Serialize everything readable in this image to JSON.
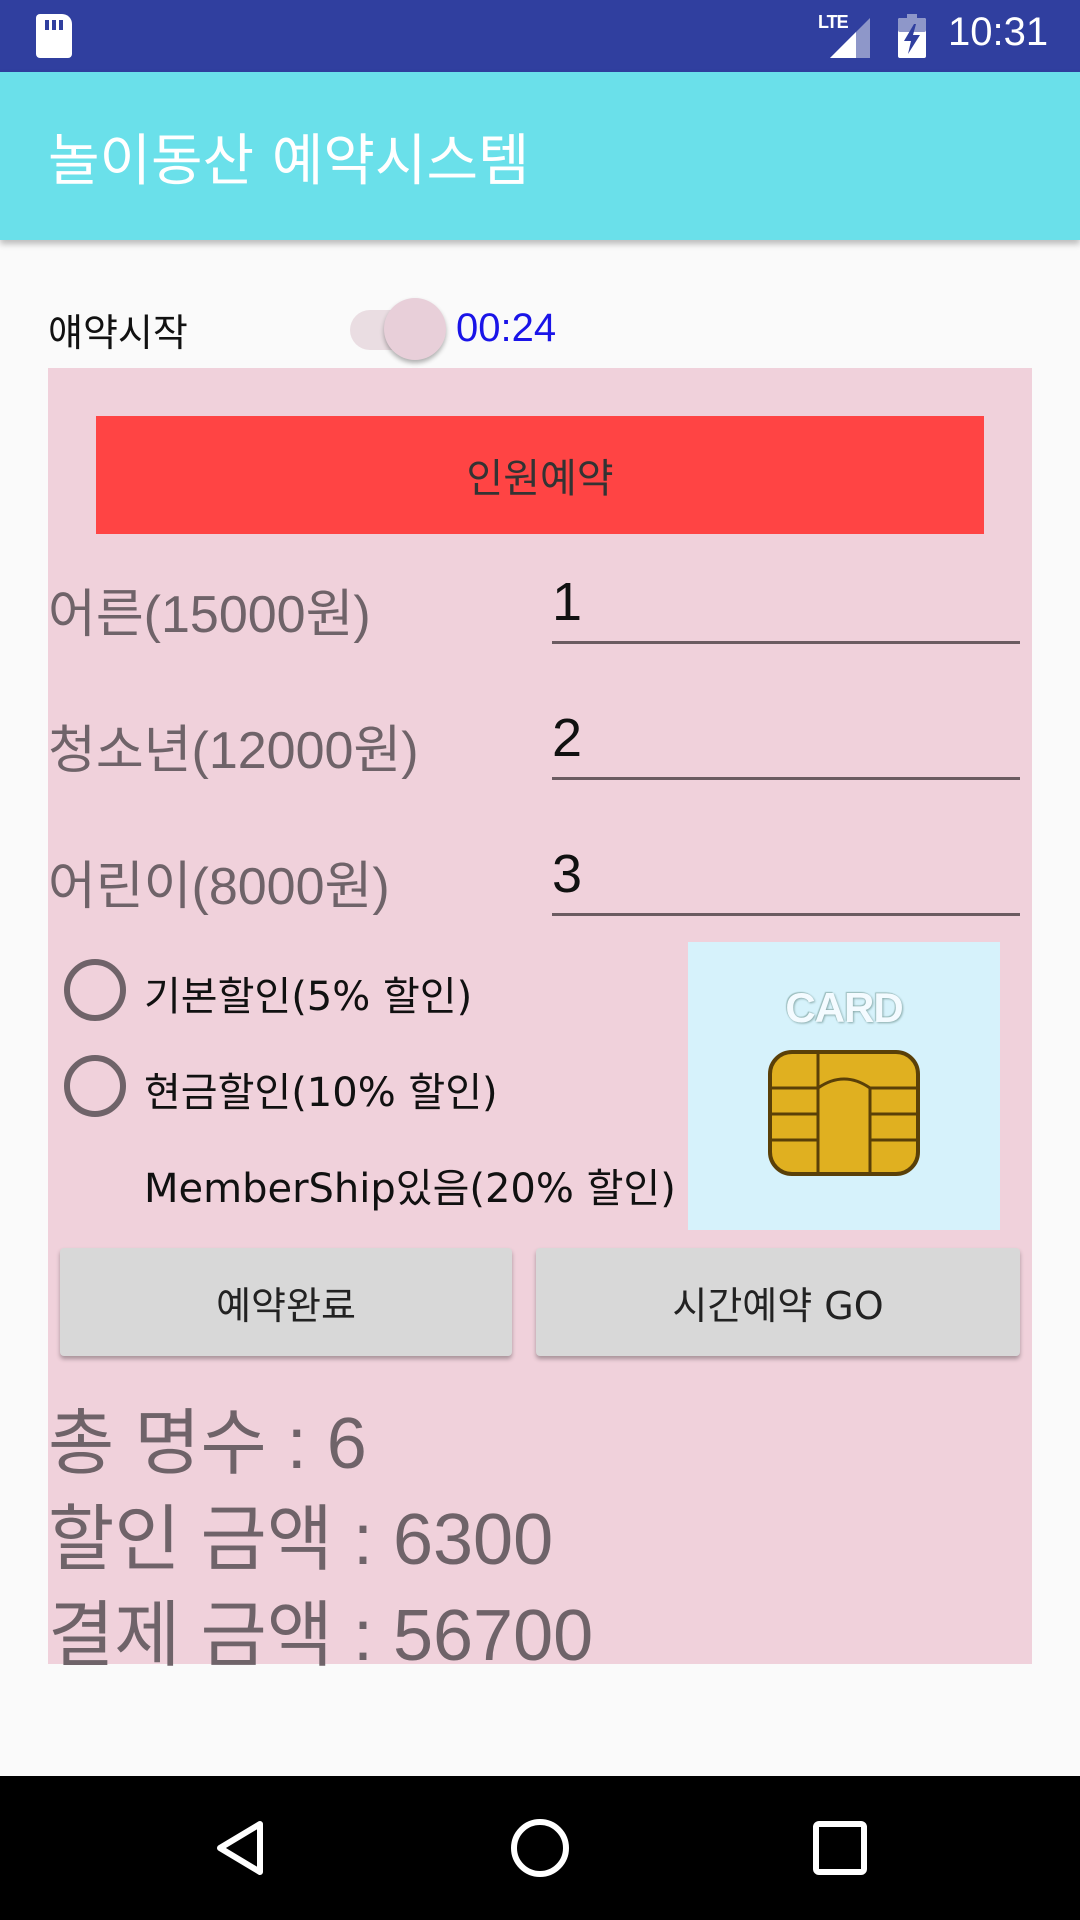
{
  "status_bar": {
    "time": "10:31",
    "network": "LTE",
    "icons": [
      "sd-card-icon",
      "lte-signal-icon",
      "battery-charging-icon"
    ]
  },
  "app_bar": {
    "title": "놀이동산 예약시스템"
  },
  "start_row": {
    "label": "얘약시작",
    "timer": "00:24",
    "switch_on": true
  },
  "reservation": {
    "header": "인원예약",
    "rows": [
      {
        "label": "어른(15000원)",
        "value": "1"
      },
      {
        "label": "청소년(12000원)",
        "value": "2"
      },
      {
        "label": "어린이(8000원)",
        "value": "3"
      }
    ],
    "discounts": [
      {
        "label": "기본할인(5% 할인)",
        "type": "radio",
        "checked": false
      },
      {
        "label": "현금할인(10% 할인)",
        "type": "radio",
        "checked": false
      },
      {
        "label": "MemberShip있음(20% 할인)",
        "type": "text"
      }
    ],
    "card_image_text": "CARD",
    "buttons": {
      "complete": "예약완료",
      "time_go": "시간예약 GO"
    },
    "summary": {
      "total_people": "총 명수 : 6",
      "discount_amount": "할인 금액 : 6300",
      "payment_amount": "결제 금액 : 56700"
    }
  },
  "colors": {
    "status_bar": "#303f9f",
    "app_bar": "#6ae0ea",
    "panel": "#f0d1db",
    "banner": "#ff4444",
    "timer": "#1a14e8"
  }
}
